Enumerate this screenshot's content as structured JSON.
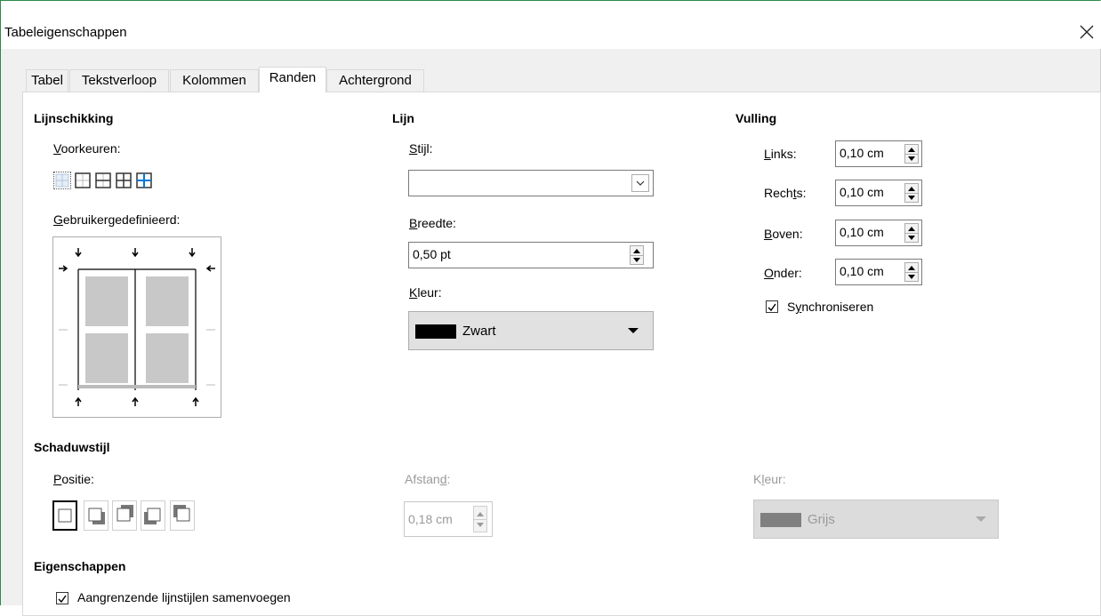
{
  "window": {
    "title": "Tabeleigenschappen",
    "close_glyph": "✕"
  },
  "tabs": [
    {
      "label": "Tabel",
      "active": false
    },
    {
      "label": "Tekstverloop",
      "active": false
    },
    {
      "label": "Kolommen",
      "active": false
    },
    {
      "label": "Randen",
      "active": true
    },
    {
      "label": "Achtergrond",
      "active": false
    }
  ],
  "line_arrangement": {
    "heading": "Lijnschikking",
    "presets_label": "Voorkeuren:",
    "presets_mnemonic": "V",
    "presets_rest": "oorkeuren:",
    "user_defined_label": "Gebruikergedefinieerd:",
    "user_defined_mnemonic": "G",
    "user_defined_rest": "ebruikergedefinieerd:"
  },
  "line": {
    "heading": "Lijn",
    "style_mnemonic": "S",
    "style_rest": "tijl:",
    "style_value": "",
    "width_mnemonic": "B",
    "width_rest": "reedte:",
    "width_value": "0,50 pt",
    "color_mnemonic": "K",
    "color_rest": "leur:",
    "color_value": "Zwart",
    "color_swatch": "#000000"
  },
  "padding": {
    "heading": "Vulling",
    "fields": [
      {
        "pre": "",
        "mnemonic": "L",
        "post": "inks:",
        "value": "0,10 cm"
      },
      {
        "pre": "Rech",
        "mnemonic": "t",
        "post": "s:",
        "value": "0,10 cm"
      },
      {
        "pre": "",
        "mnemonic": "B",
        "post": "oven:",
        "value": "0,10 cm"
      },
      {
        "pre": "",
        "mnemonic": "O",
        "post": "nder:",
        "value": "0,10 cm"
      }
    ],
    "sync_pre": "S",
    "sync_mnemonic": "y",
    "sync_post": "nchroniseren",
    "sync_checked": true
  },
  "shadow": {
    "heading": "Schaduwstijl",
    "position_mnemonic": "P",
    "position_rest": "ositie:",
    "distance_pre": "Afstan",
    "distance_mnemonic": "d",
    "distance_post": ":",
    "distance_value": "0,18 cm",
    "color_pre": "K",
    "color_mnemonic": "l",
    "color_post": "eur:",
    "color_value": "Grijs",
    "color_swatch": "#808080"
  },
  "properties": {
    "heading": "Eigenschappen",
    "merge_label": "Aangrenzende lijnstijlen samenvoegen",
    "merge_checked": true
  },
  "colors": {
    "accent_border": "#2c8a4a",
    "preset_highlight": "#0078d7"
  }
}
